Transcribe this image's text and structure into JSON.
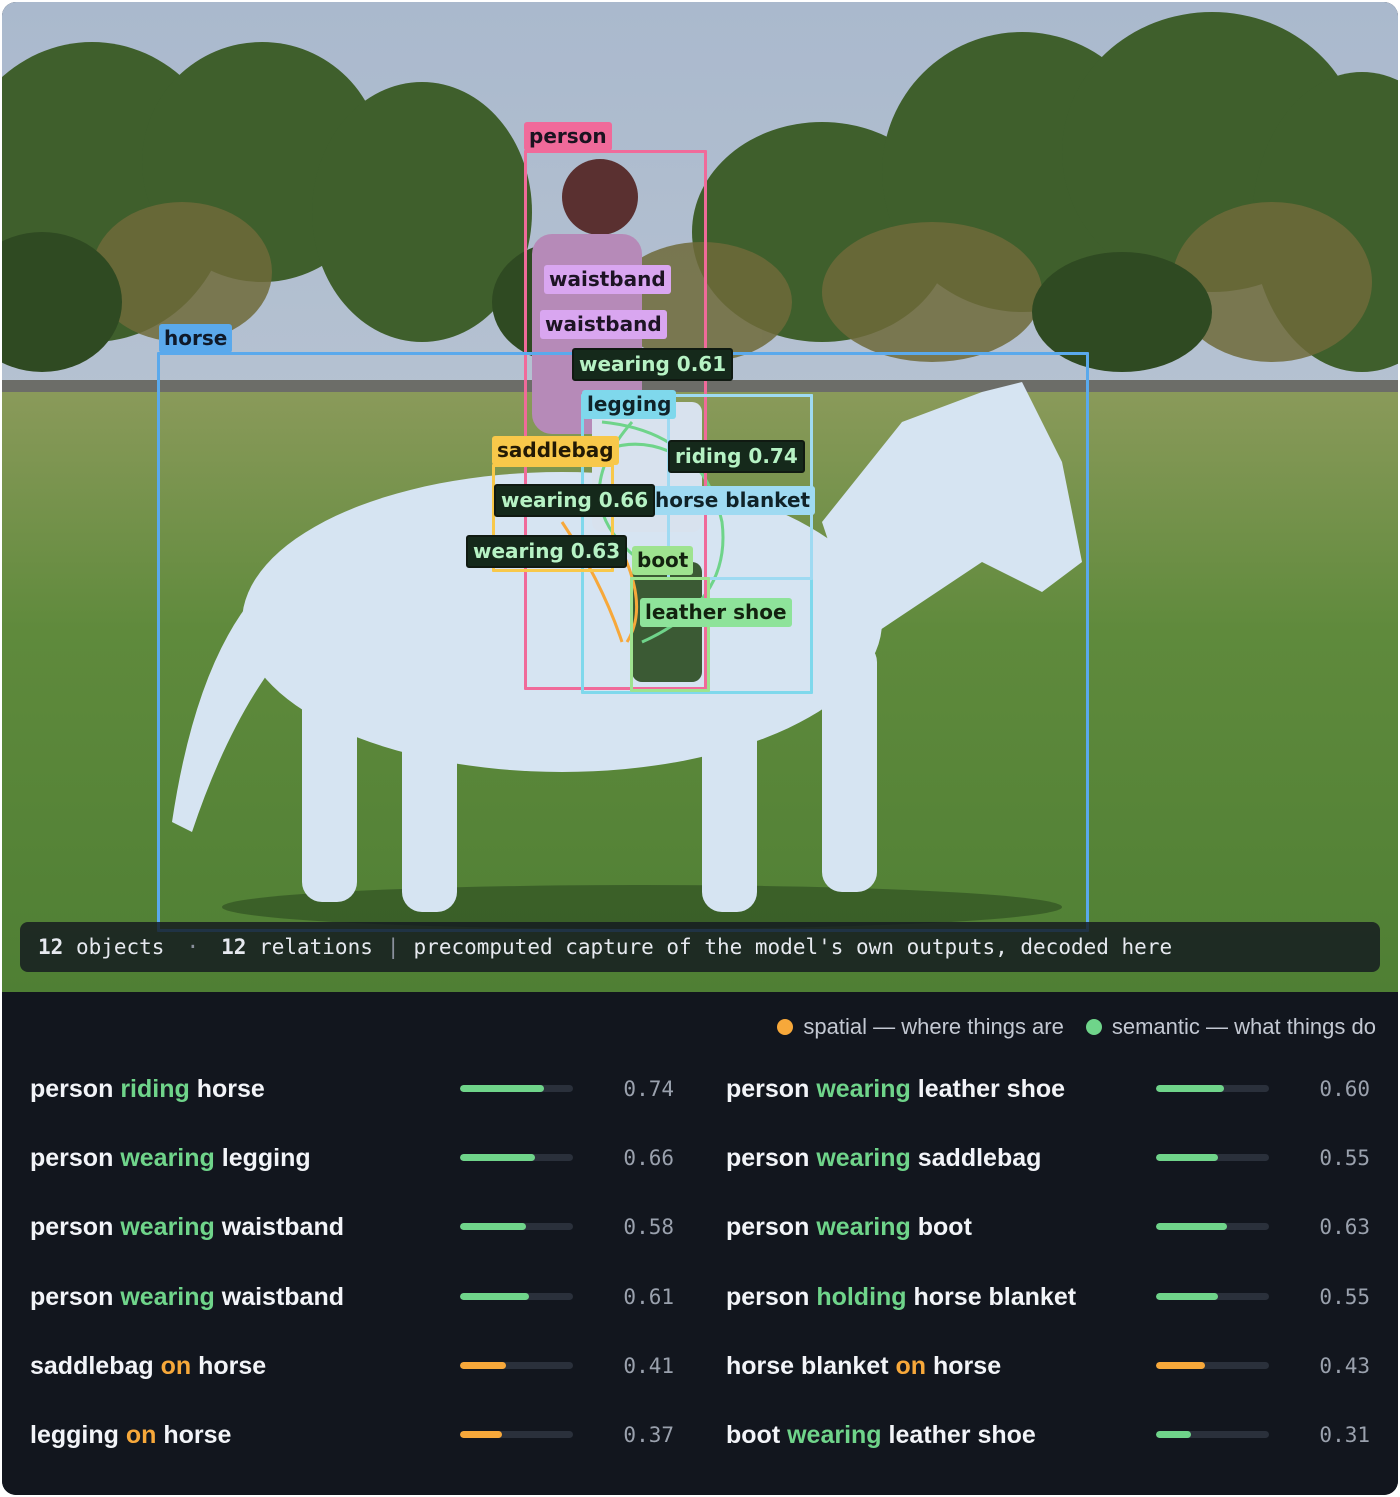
{
  "scene": {
    "objects": [
      {
        "label": "person",
        "color": "#f06a9a"
      },
      {
        "label": "horse",
        "color": "#5aa9ec"
      },
      {
        "label": "waistband",
        "color": "#d9a6f0"
      },
      {
        "label": "waistband",
        "color": "#d9a6f0"
      },
      {
        "label": "legging",
        "color": "#7fd8ec"
      },
      {
        "label": "saddlebag",
        "color": "#f8c84a"
      },
      {
        "label": "horse blanket",
        "color": "#9fdaf2"
      },
      {
        "label": "boot",
        "color": "#9ee38f"
      },
      {
        "label": "leather shoe",
        "color": "#8ee39a"
      }
    ],
    "relation_tags": [
      "wearing 0.61",
      "riding 0.74",
      "wearing 0.66",
      "wearing 0.63"
    ]
  },
  "caption": {
    "objects_count": "12",
    "objects_label": "objects",
    "separator": "·",
    "relations_count": "12",
    "relations_label": "relations",
    "divider": "|",
    "note": "precomputed capture of the model's own outputs, decoded here"
  },
  "legend": {
    "spatial": {
      "label": "spatial — where things are",
      "color": "#f7a83a"
    },
    "semantic": {
      "label": "semantic — what things do",
      "color": "#6fd48a"
    }
  },
  "relations_left": [
    {
      "subject": "person",
      "predicate": "riding",
      "object": "horse",
      "kind": "semantic",
      "score": "0.74"
    },
    {
      "subject": "person",
      "predicate": "wearing",
      "object": "legging",
      "kind": "semantic",
      "score": "0.66"
    },
    {
      "subject": "person",
      "predicate": "wearing",
      "object": "waistband",
      "kind": "semantic",
      "score": "0.58"
    },
    {
      "subject": "person",
      "predicate": "wearing",
      "object": "waistband",
      "kind": "semantic",
      "score": "0.61"
    },
    {
      "subject": "saddlebag",
      "predicate": "on",
      "object": "horse",
      "kind": "spatial",
      "score": "0.41"
    },
    {
      "subject": "legging",
      "predicate": "on",
      "object": "horse",
      "kind": "spatial",
      "score": "0.37"
    }
  ],
  "relations_right": [
    {
      "subject": "person",
      "predicate": "wearing",
      "object": "leather shoe",
      "kind": "semantic",
      "score": "0.60"
    },
    {
      "subject": "person",
      "predicate": "wearing",
      "object": "saddlebag",
      "kind": "semantic",
      "score": "0.55"
    },
    {
      "subject": "person",
      "predicate": "wearing",
      "object": "boot",
      "kind": "semantic",
      "score": "0.63"
    },
    {
      "subject": "person",
      "predicate": "holding",
      "object": "horse blanket",
      "kind": "semantic",
      "score": "0.55"
    },
    {
      "subject": "horse blanket",
      "predicate": "on",
      "object": "horse",
      "kind": "spatial",
      "score": "0.43"
    },
    {
      "subject": "boot",
      "predicate": "wearing",
      "object": "leather shoe",
      "kind": "semantic",
      "score": "0.31"
    }
  ]
}
